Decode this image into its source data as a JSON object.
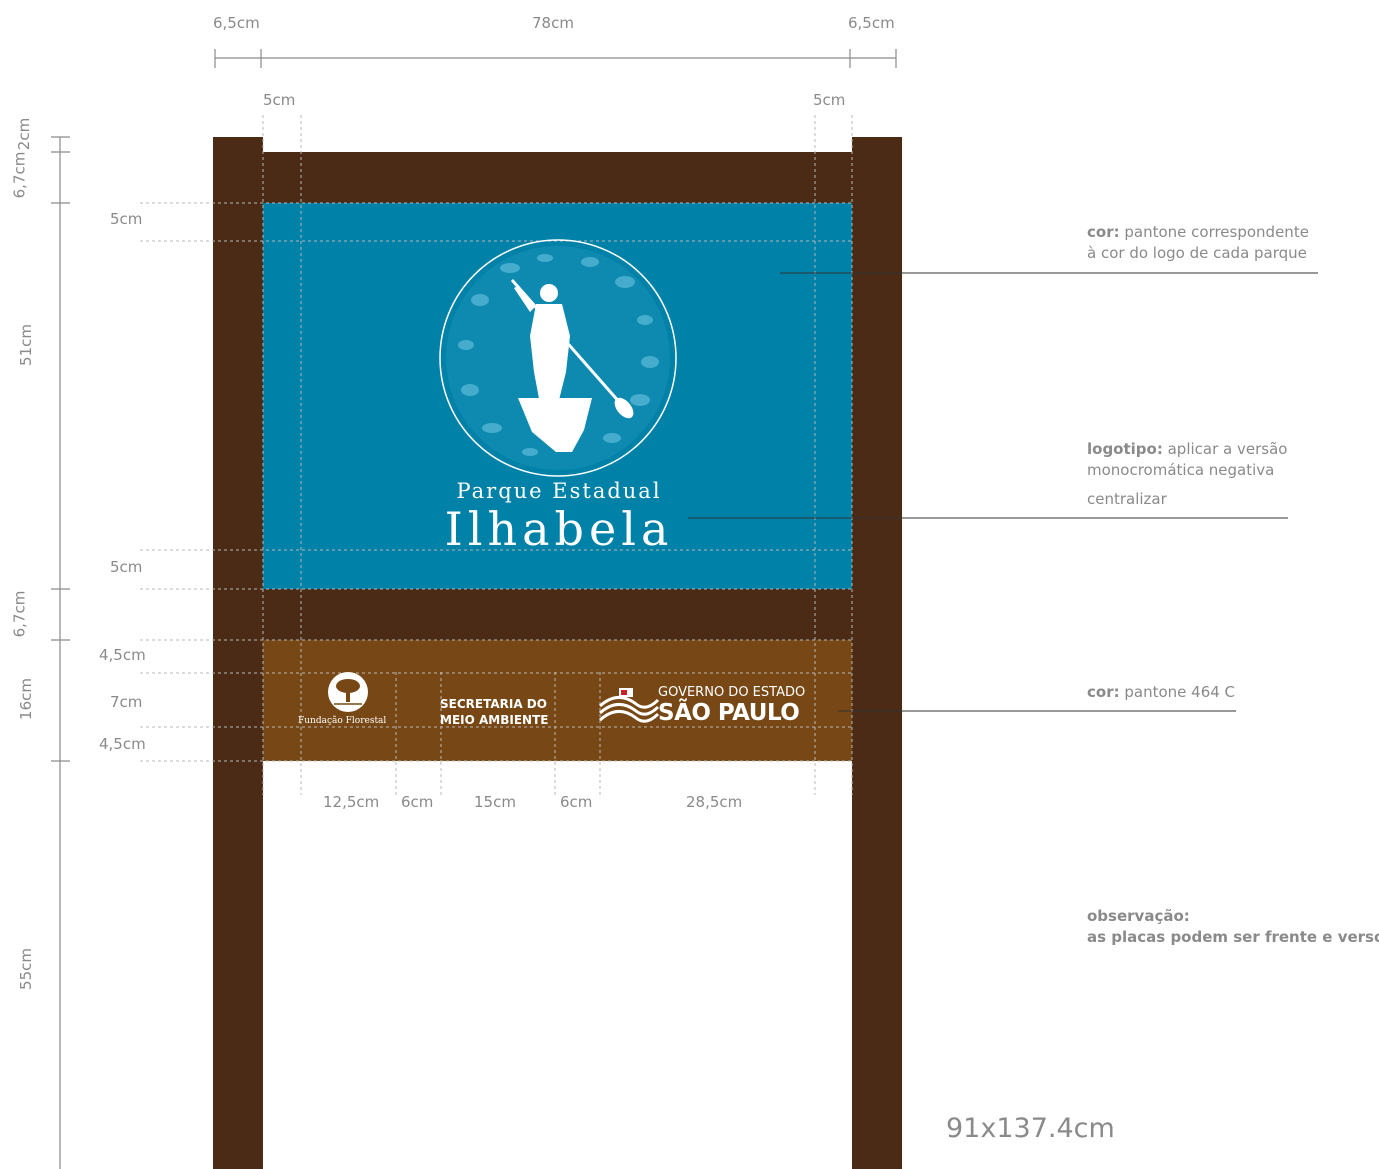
{
  "sign": {
    "colors": {
      "wood": "#4b2b15",
      "panel": "#0081a8",
      "brown_panel": "#774815",
      "line": "#8a8a8a"
    },
    "title_line1": "Parque Estadual",
    "title_line2": "Ilhabela",
    "logos": {
      "fundacao": "Fundação Florestal",
      "secretaria_line1": "SECRETARIA DO",
      "secretaria_line2": "MEIO AMBIENTE",
      "governo_line1": "GOVERNO DO ESTADO",
      "governo_line2": "SÃO PAULO"
    },
    "icons": [
      "tree-icon",
      "paddler-icon",
      "flag-stripes-icon"
    ]
  },
  "dimensions": {
    "top": [
      "6,5cm",
      "78cm",
      "6,5cm"
    ],
    "inner_top": [
      "5cm",
      "5cm"
    ],
    "left_vertical": [
      "6,7cm",
      "2cm",
      "51cm",
      "6,7cm",
      "16cm",
      "55cm"
    ],
    "left_inner": [
      "5cm",
      "5cm",
      "4,5cm",
      "7cm",
      "4,5cm"
    ],
    "bottom": [
      "12,5cm",
      "6cm",
      "15cm",
      "6cm",
      "28,5cm"
    ]
  },
  "notes": {
    "color1_bold": "cor:",
    "color1_text_line1": " pantone correspondente",
    "color1_text_line2": "à cor do logo de cada parque",
    "logo_bold": "logotipo:",
    "logo_text_line1": " aplicar a versão",
    "logo_text_line2": "monocromática negativa",
    "logo_text_line3": "centralizar",
    "color2_bold": "cor:",
    "color2_text": " pantone 464 C",
    "obs_line1": "observação:",
    "obs_line2": "as placas podem ser frente e verso"
  },
  "total_size": "91x137.4cm"
}
